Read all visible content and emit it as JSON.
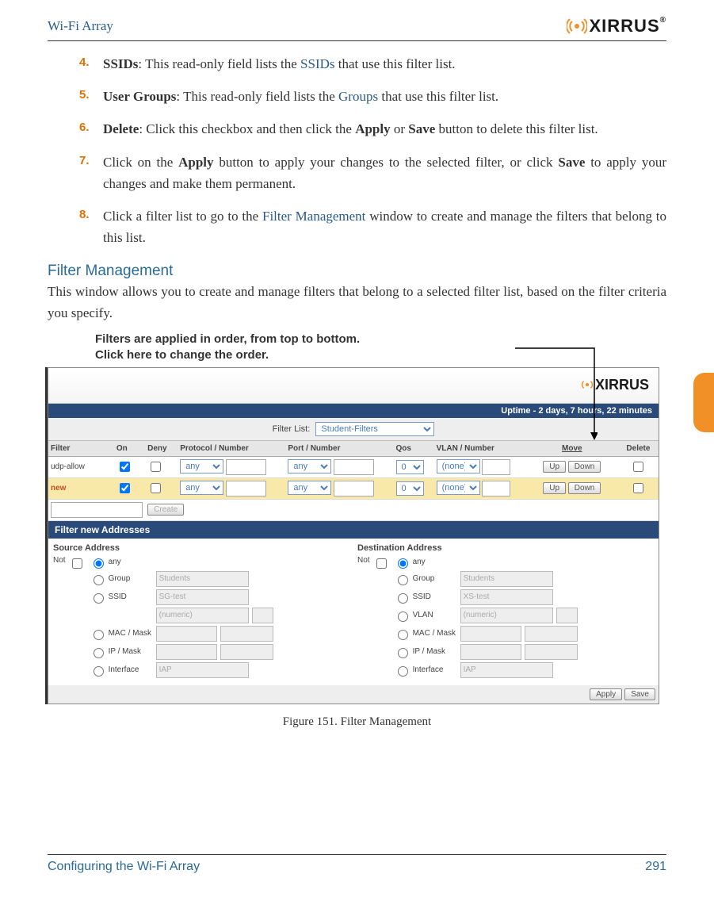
{
  "header": {
    "title": "Wi-Fi Array",
    "logo": "XIRRUS"
  },
  "items": [
    {
      "num": "4.",
      "bold": "SSIDs",
      "pre": ": This read-only field lists the ",
      "link": "SSIDs",
      "post": " that use this filter list."
    },
    {
      "num": "5.",
      "bold": "User Groups",
      "pre": ": This read-only field lists the ",
      "link": "Groups",
      "post": " that use this filter list."
    },
    {
      "num": "6.",
      "bold": "Delete",
      "text": ": Click this checkbox and then click the ",
      "b1": "Apply",
      "mid1": " or ",
      "b2": "Save",
      "post": " button to delete this filter list."
    },
    {
      "num": "7.",
      "text1": "Click on the ",
      "b1": "Apply",
      "text2": " button to apply your changes to the selected filter, or click ",
      "b2": "Save",
      "text3": " to apply your changes and make them permanent."
    },
    {
      "num": "8.",
      "text1": "Click a filter list to go to the ",
      "link": "Filter Management",
      "text2": " window to create and manage the filters that belong to this list."
    }
  ],
  "section": {
    "title": "Filter Management",
    "text": "This window allows you to create and manage filters that belong to a selected filter list, based on the filter criteria you specify."
  },
  "annotation": {
    "line1": "Filters are applied in order, from top to bottom.",
    "line2": "Click here to change the order."
  },
  "screenshot": {
    "uptime": "Uptime - 2 days, 7 hours, 22 minutes",
    "filterlist_label": "Filter List:",
    "filterlist_value": "Student-Filters",
    "headers": {
      "filter": "Filter",
      "on": "On",
      "deny": "Deny",
      "protocol": "Protocol / Number",
      "port": "Port / Number",
      "qos": "Qos",
      "vlan": "VLAN / Number",
      "move": "Move",
      "delete": "Delete"
    },
    "row1": {
      "name": "udp-allow",
      "on": true,
      "deny": false,
      "protocol": "any",
      "port": "any",
      "qos": "0",
      "vlan": "(none)",
      "up": "Up",
      "down": "Down"
    },
    "row2": {
      "name": "new",
      "on": true,
      "deny": false,
      "protocol": "any",
      "port": "any",
      "qos": "0",
      "vlan": "(none)",
      "up": "Up",
      "down": "Down"
    },
    "create": "Create",
    "section_bar": "Filter new  Addresses",
    "src": {
      "title": "Source Address",
      "not": "Not",
      "any": "any",
      "group": "Group",
      "ssid": "SSID",
      "mac": "MAC / Mask",
      "ip": "IP / Mask",
      "iface": "Interface",
      "group_val": "Students",
      "ssid_val": "SG-test",
      "num_val": "(numeric)",
      "iface_val": "IAP"
    },
    "dst": {
      "title": "Destination Address",
      "not": "Not",
      "any": "any",
      "group": "Group",
      "ssid": "SSID",
      "vlan": "VLAN",
      "mac": "MAC / Mask",
      "ip": "IP / Mask",
      "iface": "Interface",
      "group_val": "Students",
      "ssid_val": "XS-test",
      "num_val": "(numeric)",
      "iface_val": "IAP"
    },
    "apply": "Apply",
    "save": "Save"
  },
  "caption": "Figure 151. Filter Management",
  "footer": {
    "left": "Configuring the Wi-Fi Array",
    "right": "291"
  }
}
